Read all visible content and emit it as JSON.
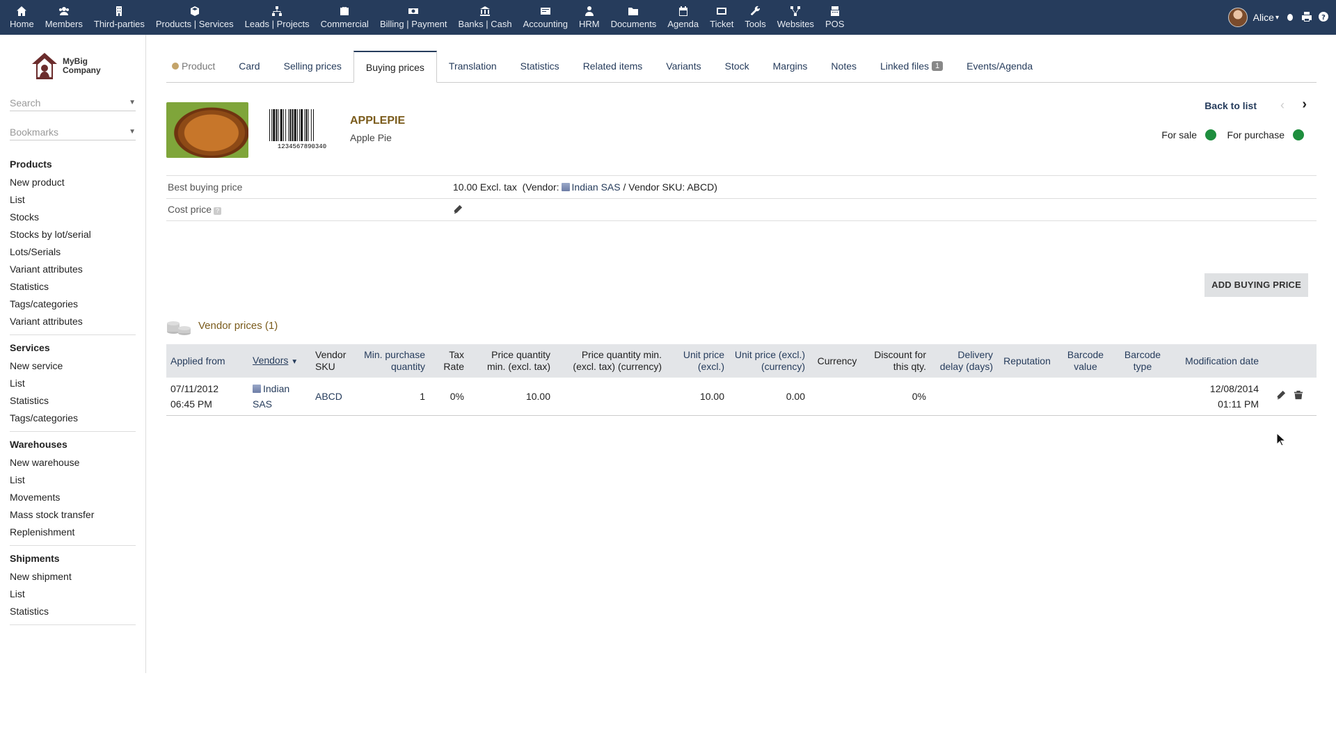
{
  "topnav": [
    {
      "label": "Home",
      "icon": "home-icon"
    },
    {
      "label": "Members",
      "icon": "members-icon"
    },
    {
      "label": "Third-parties",
      "icon": "building-icon"
    },
    {
      "label": "Products | Services",
      "icon": "cube-icon"
    },
    {
      "label": "Leads | Projects",
      "icon": "sitemap-icon"
    },
    {
      "label": "Commercial",
      "icon": "briefcase-icon"
    },
    {
      "label": "Billing | Payment",
      "icon": "money-icon"
    },
    {
      "label": "Banks | Cash",
      "icon": "bank-icon"
    },
    {
      "label": "Accounting",
      "icon": "ledger-icon"
    },
    {
      "label": "HRM",
      "icon": "user-tie-icon"
    },
    {
      "label": "Documents",
      "icon": "folder-icon"
    },
    {
      "label": "Agenda",
      "icon": "calendar-icon"
    },
    {
      "label": "Ticket",
      "icon": "ticket-icon"
    },
    {
      "label": "Tools",
      "icon": "wrench-icon"
    },
    {
      "label": "Websites",
      "icon": "network-icon"
    },
    {
      "label": "POS",
      "icon": "cash-register-icon"
    }
  ],
  "user": {
    "name": "Alice"
  },
  "logo": {
    "line1": "MyBig",
    "line2": "Company"
  },
  "sidebar": {
    "search_placeholder": "Search",
    "bookmarks_placeholder": "Bookmarks",
    "sections": [
      {
        "title": "Products",
        "links": [
          "New product",
          "List",
          "Stocks",
          "Stocks by lot/serial",
          "Lots/Serials",
          "Variant attributes",
          "Statistics",
          "Tags/categories",
          "Variant attributes"
        ]
      },
      {
        "title": "Services",
        "links": [
          "New service",
          "List",
          "Statistics",
          "Tags/categories"
        ]
      },
      {
        "title": "Warehouses",
        "links": [
          "New warehouse",
          "List",
          "Movements",
          "Mass stock transfer",
          "Replenishment"
        ]
      },
      {
        "title": "Shipments",
        "links": [
          "New shipment",
          "List",
          "Statistics"
        ]
      }
    ]
  },
  "tabs": [
    {
      "label": "Product"
    },
    {
      "label": "Card"
    },
    {
      "label": "Selling prices"
    },
    {
      "label": "Buying prices",
      "active": true
    },
    {
      "label": "Translation"
    },
    {
      "label": "Statistics"
    },
    {
      "label": "Related items"
    },
    {
      "label": "Variants"
    },
    {
      "label": "Stock"
    },
    {
      "label": "Margins"
    },
    {
      "label": "Notes"
    },
    {
      "label": "Linked files",
      "badge": "1"
    },
    {
      "label": "Events/Agenda"
    }
  ],
  "product": {
    "ref": "APPLEPIE",
    "label": "Apple Pie",
    "barcode_text": "1234567890340",
    "back_to_list": "Back to list",
    "for_sale": "For sale",
    "for_purchase": "For purchase",
    "status_color": "#1e8e3e"
  },
  "info": {
    "best_buying_label": "Best buying price",
    "best_buying_value": "10.00 Excl. tax",
    "vendor_prefix": "(Vendor:",
    "vendor_name": "Indian SAS",
    "vendor_suffix": "/ Vendor SKU: ABCD)",
    "cost_price_label": "Cost price"
  },
  "add_button": "ADD BUYING PRICE",
  "vendor_prices_title": "Vendor prices (1)",
  "table": {
    "headers": [
      {
        "label": "Applied from",
        "link": true,
        "align": "l"
      },
      {
        "label": "Vendors",
        "link": true,
        "align": "l",
        "sort": true
      },
      {
        "label": "Vendor SKU",
        "align": "l"
      },
      {
        "label": "Min. purchase quantity",
        "link": true,
        "align": "r"
      },
      {
        "label": "Tax Rate",
        "align": "r"
      },
      {
        "label": "Price quantity min. (excl. tax)",
        "align": "r"
      },
      {
        "label": "Price quantity min. (excl. tax) (currency)",
        "align": "r"
      },
      {
        "label": "Unit price (excl.)",
        "link": true,
        "align": "r"
      },
      {
        "label": "Unit price (excl.) (currency)",
        "link": true,
        "align": "r"
      },
      {
        "label": "Currency",
        "align": "c"
      },
      {
        "label": "Discount for this qty.",
        "align": "r"
      },
      {
        "label": "Delivery delay (days)",
        "link": true,
        "align": "r"
      },
      {
        "label": "Reputation",
        "link": true,
        "align": "c"
      },
      {
        "label": "Barcode value",
        "link": true,
        "align": "c"
      },
      {
        "label": "Barcode type",
        "link": true,
        "align": "c"
      },
      {
        "label": "Modification date",
        "link": true,
        "align": "r"
      }
    ],
    "rows": [
      {
        "applied_from_date": "07/11/2012",
        "applied_from_time": "06:45 PM",
        "vendor_line1": "Indian",
        "vendor_line2": "SAS",
        "sku": "ABCD",
        "min_qty": "1",
        "tax_rate": "0%",
        "price_min": "10.00",
        "price_min_currency": "",
        "unit_price": "10.00",
        "unit_price_currency": "0.00",
        "currency": "",
        "discount": "0%",
        "delivery_delay": "",
        "reputation": "",
        "barcode_value": "",
        "barcode_type": "",
        "mod_date": "12/08/2014",
        "mod_time": "01:11 PM"
      }
    ]
  },
  "colors": {
    "topbar": "#263c5c",
    "link": "#263c5c",
    "ref": "#7a5b1b"
  }
}
